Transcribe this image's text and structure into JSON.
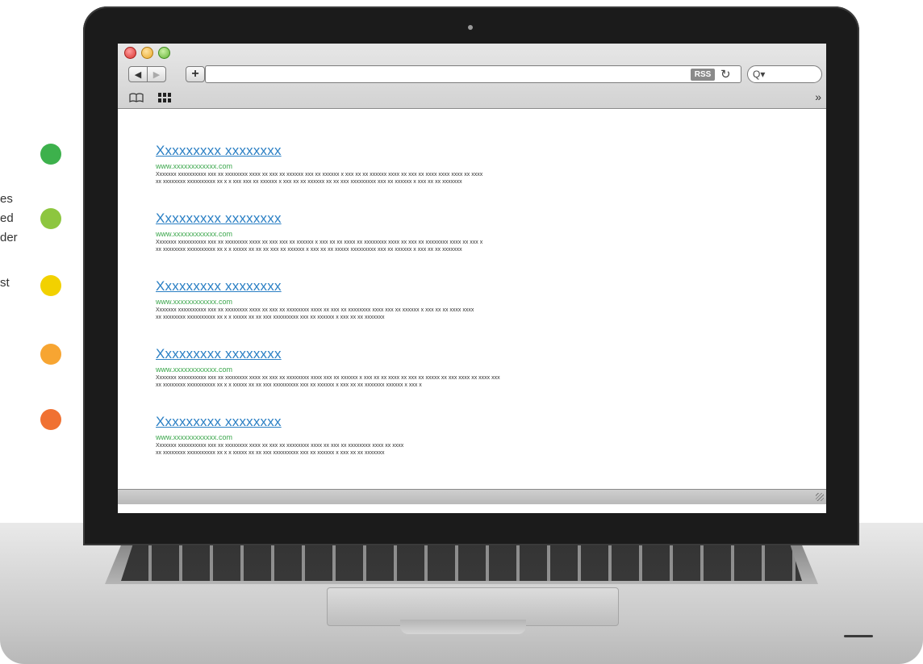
{
  "side_labels": [
    "es",
    "ed",
    "der",
    "st"
  ],
  "colors": {
    "dot_1": "#3db14c",
    "dot_2": "#8dc63f",
    "dot_3": "#f2d100",
    "dot_4": "#f7a532",
    "dot_5": "#f07132",
    "link": "#2a7fc4",
    "url_green": "#3aa64b"
  },
  "browser": {
    "traffic_lights": [
      "close",
      "minimize",
      "zoom"
    ],
    "back_icon": "◀",
    "forward_icon": "▶",
    "new_tab_icon": "+",
    "rss_label": "RSS",
    "reload_icon": "↻",
    "search_icon": "search-icon",
    "search_glyph": "Q▾",
    "bookmarks_icon": "open-book-icon",
    "top_sites_icon": "grid-icon",
    "more_icon": "»"
  },
  "results": [
    {
      "title": "Xxxxxxxxx xxxxxxxx",
      "url": "www.xxxxxxxxxxxx.com",
      "line1": "Xxxxxxx xxxxxxxxxx xxx xx xxxxxxxx xxxx xx xxx xx xxxxxx xxx xx xxxxxx x xxx xx xx xxxxxx xxxx xx xxx xx xxxx xxxx xxxx xx xxxx",
      "line2": "xx xxxxxxxx xxxxxxxxxx xx x x xxx xxx xx xxxxxx x xxx xx xx xxxxxx xx xx xxx xxxxxxxxx xxx xx xxxxxx x xxx xx xx xxxxxxx"
    },
    {
      "title": "Xxxxxxxxx xxxxxxxx",
      "url": "www.xxxxxxxxxxxx.com",
      "line1": "Xxxxxxx xxxxxxxxxx xxx xx xxxxxxxx xxxx xx xxx xxx xx xxxxxx x xxx xx xx xxxx xx xxxxxxxx xxxx xx xxx xx xxxxxxxx xxxx xx xxx x",
      "line2": "xx xxxxxxxx xxxxxxxxxx xx x x xxxxx xx xx xx xxx xx xxxxxx x xxx xx xx xxxxx xxxxxxxxx xxx xx xxxxxx x xxx xx xx xxxxxxx"
    },
    {
      "title": "Xxxxxxxxx xxxxxxxx",
      "url": "www.xxxxxxxxxxxx.com",
      "line1": "Xxxxxxx xxxxxxxxxx xxx xx xxxxxxxx xxxx xx xxx xx xxxxxxxx xxxx xx xxx xx xxxxxxxx xxxx xxx xx xxxxxx x xxx xx xx xxxx xxxx",
      "line2": "xx xxxxxxxx xxxxxxxxxx xx x x xxxxx xx xx xxx xxxxxxxxx xxx xx xxxxxx x xxx xx xx xxxxxxx"
    },
    {
      "title": "Xxxxxxxxx xxxxxxxx",
      "url": "www.xxxxxxxxxxxx.com",
      "line1": "Xxxxxxx xxxxxxxxxx xxx xx xxxxxxxx xxxx xx xxx xx xxxxxxxx xxxx xxx xx xxxxxx x xxx xx xx xxxx xx xxx xx xxxxx xx xxx xxxx xx xxxx xxx",
      "line2": "xx xxxxxxxx xxxxxxxxxx xx x x xxxxx xx xx xxx xxxxxxxxx xxx xx xxxxxx x xxx xx xx xxxxxxx xxxxxx x xxx x"
    },
    {
      "title": "Xxxxxxxxx xxxxxxxx",
      "url": "www.xxxxxxxxxxxx.com",
      "line1": "Xxxxxxx xxxxxxxxxx xxx xx xxxxxxxx xxxx xx xxx xx xxxxxxxx xxxx xx xxx xx xxxxxxxx xxxx xx xxxx",
      "line2": "xx xxxxxxxx xxxxxxxxxx xx x x xxxxx xx xx xxx xxxxxxxxx xxx xx xxxxxx x xxx xx xx xxxxxxx"
    }
  ]
}
